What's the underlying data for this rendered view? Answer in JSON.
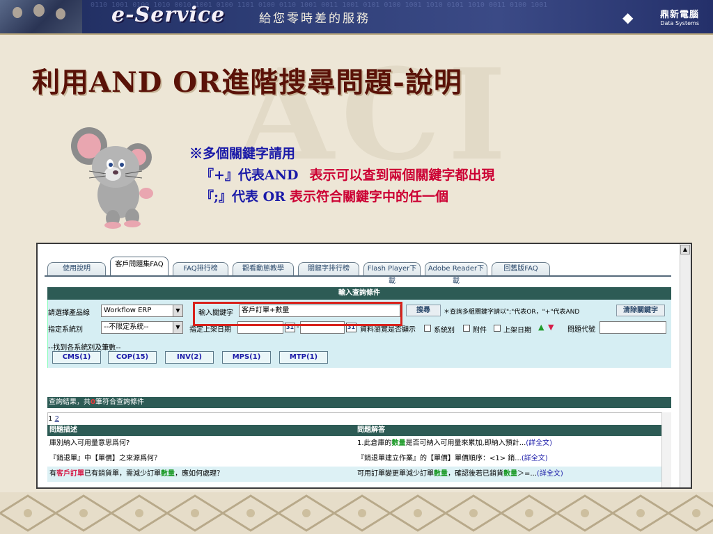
{
  "banner": {
    "brand": "e-Service",
    "slogan": "給您零時差的服務",
    "corp_zh": "鼎新電腦",
    "corp_en": "Data Systems",
    "binary_text": "0110 1001 0100 1010 0010 1001 0100 1101 0100 0110 1001 0011 1001 0101 0100 1001 1010 0101 1010 0011 0100 1001"
  },
  "slide": {
    "title": "利用AND OR進階搜尋問題-說明",
    "watermark": "ACI"
  },
  "notes": {
    "line1": "※多個關鍵字請用",
    "line2_symbol": "『+』代表AND",
    "line2_desc": "表示可以查到兩個關鍵字都出現",
    "line3_symbol": "『;』代表 OR",
    "line3_desc": "表示符合關鍵字中的任一個"
  },
  "app": {
    "tabs": [
      {
        "label": "使用說明",
        "active": false
      },
      {
        "label": "客戶問題集FAQ",
        "active": true
      },
      {
        "label": "FAQ排行榜",
        "active": false
      },
      {
        "label": "觀看動態教學",
        "active": false
      },
      {
        "label": "關鍵字排行榜",
        "active": false
      },
      {
        "label": "Flash Player下載",
        "active": false
      },
      {
        "label": "Adobe Reader下載",
        "active": false
      },
      {
        "label": "回舊版FAQ",
        "active": false
      }
    ],
    "section_title": "輸入查詢條件",
    "product_label": "請選擇產品線",
    "product_value": "Workflow ERP",
    "keyword_label": "輸入關鍵字",
    "keyword_value": "客戶訂單+數量",
    "search_button": "搜尋",
    "keyword_hint": "＊查詢多組關鍵字請以\";\"代表OR，\"+\"代表AND",
    "clear_button": "清除關鍵字",
    "system_label": "指定系統別",
    "system_value": "--不限定系統--",
    "date_label": "指定上架日期",
    "date_sep": "-",
    "cal_icon_text": "31",
    "display_label": "資料瀏覽是否顯示",
    "opt_system": "系統別",
    "opt_attach": "附件",
    "opt_date": "上架日期",
    "code_label": "問題代號",
    "systems_heading": "--找到各系統別及筆數--",
    "systems": [
      {
        "label": "CMS(1)"
      },
      {
        "label": "COP(15)"
      },
      {
        "label": "INV(2)"
      },
      {
        "label": "MPS(1)"
      },
      {
        "label": "MTP(1)"
      }
    ],
    "result_prefix": "查詢結果，共",
    "result_count": "0",
    "result_suffix": "筆符合查詢條件",
    "pager_current": "1",
    "pager_next": "2",
    "col_question": "問題描述",
    "col_answer": "問題解答",
    "rows": [
      {
        "q": "庫別納入可用量意思爲何?",
        "a_pre": "1.此倉庫的",
        "a_kw": "數量",
        "a_post": "是否可納入可用量來累加,即納入預計...",
        "more": "(詳全文)"
      },
      {
        "q": "『銷退單』中【單價】之來源爲何？",
        "a_pre": "『銷退單建立作業』的【單價】單價順序：<1> 銷...",
        "a_kw": "",
        "a_post": "",
        "more": "(詳全文)"
      },
      {
        "q_pre": "有",
        "q_kw1": "客戶訂單",
        "q_mid": "已有銷貨單，需減少訂單",
        "q_kw2": "數量",
        "q_post": "，應如何處理？",
        "a_pre": "可用訂單變更單減少訂單",
        "a_kw": "數量",
        "a_mid": "，確認後若已銷貨",
        "a_kw2": "數量",
        "a_post": "＞=...",
        "more": "(詳全文)"
      }
    ]
  },
  "colors": {
    "title": "#5a1208",
    "note_blue": "#1a1aa8",
    "note_red": "#cc0033",
    "header_teal": "#2d5b55",
    "panel_bg": "#d6eef3",
    "highlight": "#d8211b"
  }
}
